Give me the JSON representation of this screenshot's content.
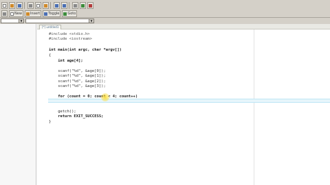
{
  "toolbar": {
    "row1": [
      {
        "name": "new-file",
        "icon": "new-file-icon",
        "label": ""
      },
      {
        "name": "open",
        "icon": "open-icon",
        "label": ""
      },
      {
        "name": "save",
        "icon": "save-icon",
        "label": ""
      },
      {
        "name": "cut",
        "icon": "cut-icon",
        "label": ""
      },
      {
        "name": "copy",
        "icon": "copy-icon",
        "label": ""
      },
      {
        "name": "paste",
        "icon": "paste-icon",
        "label": ""
      },
      {
        "name": "undo",
        "icon": "undo-icon",
        "label": ""
      },
      {
        "name": "redo",
        "icon": "redo-icon",
        "label": ""
      },
      {
        "name": "find",
        "icon": "find-icon",
        "label": ""
      }
    ],
    "new_label": "New",
    "insert_label": "Insert",
    "toggle_label": "Toggle",
    "goto_label": "Goto"
  },
  "tab": {
    "label": "[*] untitled1"
  },
  "code_lines": [
    "#include <stdio.h>",
    "#include <iostream>",
    "",
    "int main(int argc, char *argv[])",
    "{",
    "    int age[4];",
    "",
    "    scanf(\"%d\", &age[0]);",
    "    scanf(\"%d\", &age[1]);",
    "    scanf(\"%d\", &age[2]);",
    "    scanf(\"%d\", &age[3]);",
    "",
    "    for (count = 0; count < 4; count++)",
    "",
    "",
    "    getch();",
    "    return EXIT_SUCCESS;",
    "}"
  ]
}
